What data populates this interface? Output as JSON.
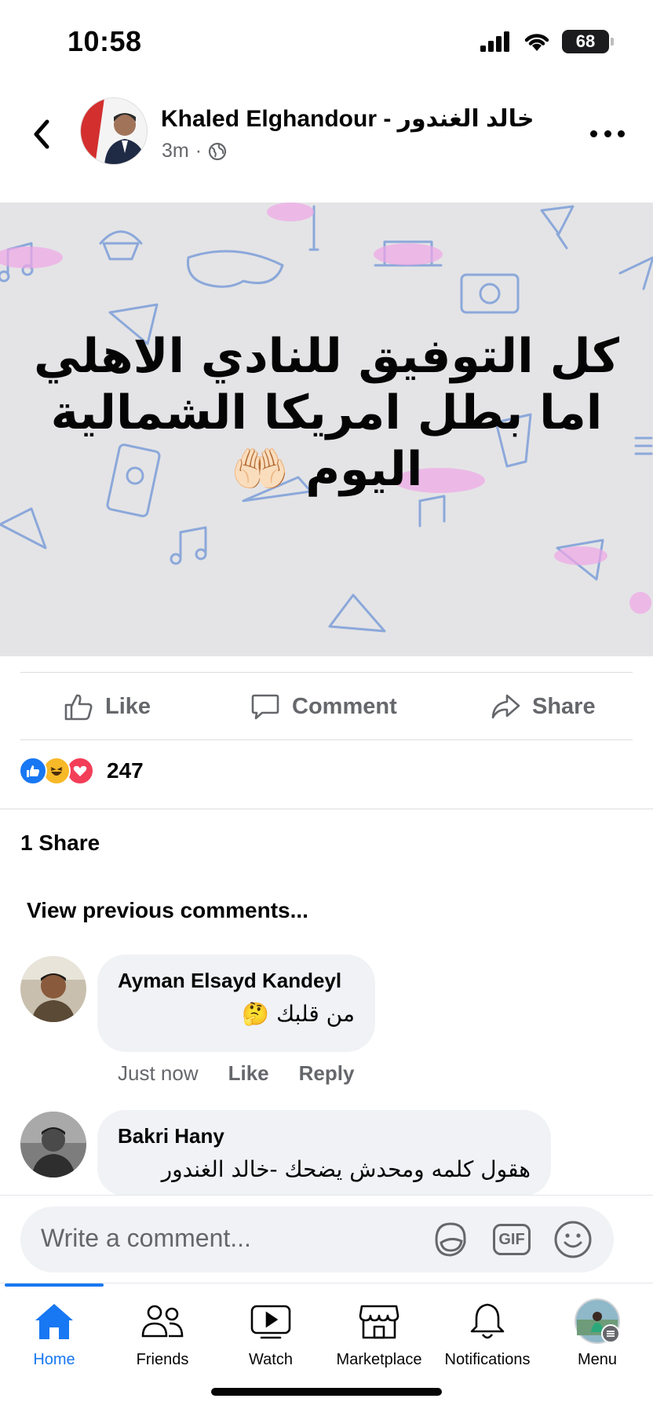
{
  "status_bar": {
    "time": "10:58",
    "battery": "68"
  },
  "post": {
    "author": "Khaled Elghandour - خالد الغندور",
    "time_ago": "3m",
    "privacy_icon": "globe-icon",
    "image_text_lines": [
      "كل التوفيق للنادي الاهلي",
      "اما بطل امريكا الشمالية",
      "اليوم 🤲🏻"
    ]
  },
  "actions": {
    "like": "Like",
    "comment": "Comment",
    "share": "Share"
  },
  "engagement": {
    "reaction_icons": [
      "like-icon",
      "haha-icon",
      "love-icon"
    ],
    "reaction_count": "247",
    "shares": "1 Share"
  },
  "comments_section": {
    "view_previous": "View previous comments...",
    "comments": [
      {
        "name": "Ayman Elsayd Kandeyl",
        "text": "من قلبك 🤔",
        "time": "Just now",
        "like_label": "Like",
        "reply_label": "Reply"
      },
      {
        "name": "Bakri Hany",
        "text": "هقول كلمه ومحدش يضحك -خالد الغندور"
      }
    ]
  },
  "composer": {
    "placeholder": "Write a comment...",
    "gif_label": "GIF"
  },
  "tabbar": {
    "active": "Home",
    "colors": {
      "active": "#1877f2",
      "inactive": "#65676b"
    },
    "tabs": [
      {
        "label": "Home"
      },
      {
        "label": "Friends"
      },
      {
        "label": "Watch"
      },
      {
        "label": "Marketplace"
      },
      {
        "label": "Notifications"
      },
      {
        "label": "Menu"
      }
    ]
  }
}
